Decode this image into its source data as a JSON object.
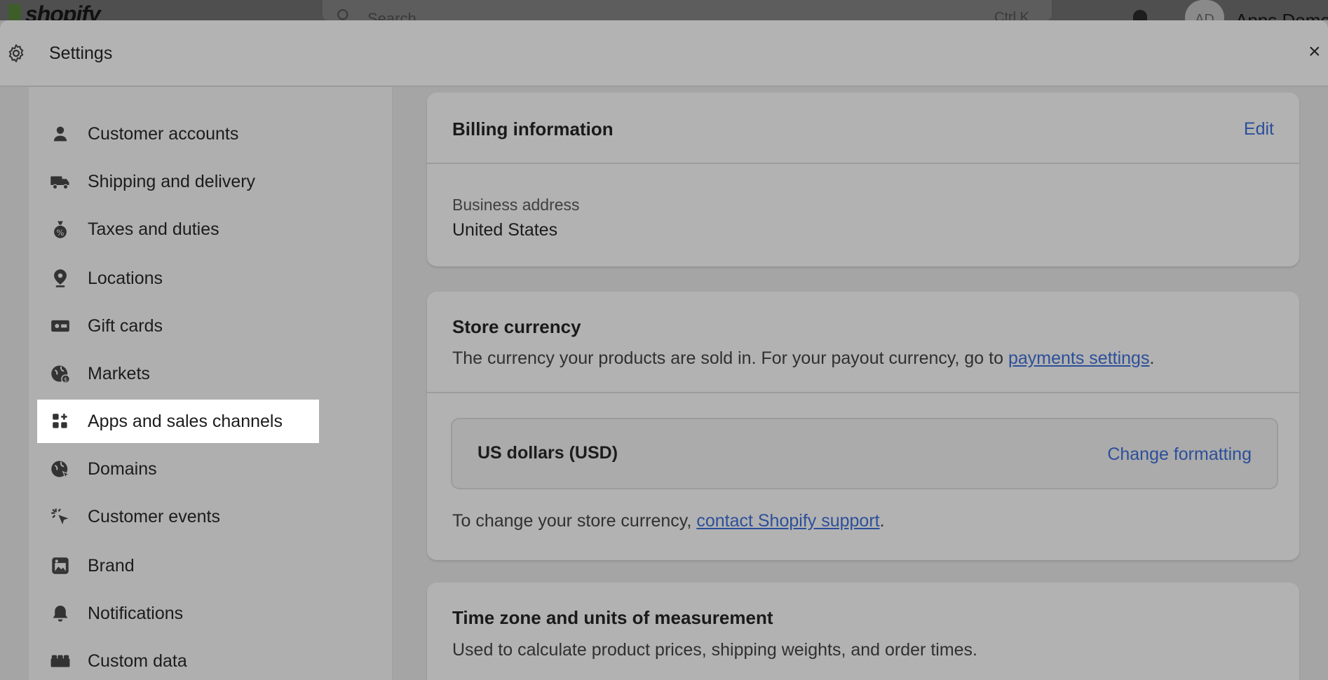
{
  "topbar": {
    "logo_text": "shopify",
    "search_placeholder": "Search",
    "search_shortcut": "Ctrl K",
    "avatar_initials": "AD",
    "store_name": "Apps Demo"
  },
  "modal": {
    "title": "Settings",
    "close_label": "×"
  },
  "sidebar": {
    "items": [
      {
        "label": "Customer accounts",
        "icon": "person-icon"
      },
      {
        "label": "Shipping and delivery",
        "icon": "truck-icon"
      },
      {
        "label": "Taxes and duties",
        "icon": "tax-bag-icon"
      },
      {
        "label": "Locations",
        "icon": "location-pin-icon"
      },
      {
        "label": "Gift cards",
        "icon": "gift-card-icon"
      },
      {
        "label": "Markets",
        "icon": "globe-money-icon"
      },
      {
        "label": "Apps and sales channels",
        "icon": "apps-icon",
        "active": true
      },
      {
        "label": "Domains",
        "icon": "globe-icon"
      },
      {
        "label": "Customer events",
        "icon": "cursor-click-icon"
      },
      {
        "label": "Brand",
        "icon": "image-icon"
      },
      {
        "label": "Notifications",
        "icon": "bell-icon"
      },
      {
        "label": "Custom data",
        "icon": "database-icon"
      }
    ]
  },
  "billing": {
    "title": "Billing information",
    "edit_label": "Edit",
    "address_label": "Business address",
    "address_value": "United States"
  },
  "store_currency": {
    "title": "Store currency",
    "desc_prefix": "The currency your products are sold in. For your payout currency, go to ",
    "desc_link": "payments settings",
    "desc_suffix": ".",
    "currency_name": "US dollars (USD)",
    "change_label": "Change formatting",
    "footer_prefix": "To change your store currency, ",
    "footer_link": "contact Shopify support",
    "footer_suffix": "."
  },
  "timezone": {
    "title": "Time zone and units of measurement",
    "desc": "Used to calculate product prices, shipping weights, and order times."
  },
  "colors": {
    "link": "#2c4f99",
    "active_nav_bg": "#ffffff",
    "overlay_bg": "#a5a5a5"
  }
}
